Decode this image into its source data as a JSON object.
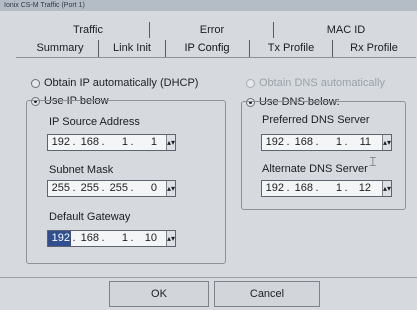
{
  "window": {
    "title": "Ionix CS-M Traffic (Port 1)"
  },
  "tabs": {
    "back_row": [
      "Traffic",
      "Error",
      "MAC ID"
    ],
    "front_row": [
      "Summary",
      "Link Init",
      "IP Config",
      "Tx Profile",
      "Rx Profile"
    ],
    "selected": "IP Config"
  },
  "ip_mode": {
    "auto_label": "Obtain IP automatically (DHCP)",
    "manual_label": "Use IP below",
    "selected": "Use IP below"
  },
  "ip_fields": {
    "source": {
      "label": "IP Source Address",
      "octets": [
        "192",
        "168",
        "1",
        "1"
      ]
    },
    "mask": {
      "label": "Subnet Mask",
      "octets": [
        "255",
        "255",
        "255",
        "0"
      ]
    },
    "gateway": {
      "label": "Default Gateway",
      "octets": [
        "192",
        "168",
        "1",
        "10"
      ],
      "highlighted_octet": 0
    }
  },
  "dns_mode": {
    "auto_label": "Obtain DNS automatically",
    "auto_disabled": true,
    "manual_label": "Use DNS below:",
    "selected": "Use DNS below:"
  },
  "dns_fields": {
    "preferred": {
      "label": "Preferred DNS Server",
      "octets": [
        "192",
        "168",
        "1",
        "11"
      ]
    },
    "alternate": {
      "label": "Alternate DNS Server",
      "octets": [
        "192",
        "168",
        "1",
        "12"
      ]
    }
  },
  "buttons": {
    "ok": "OK",
    "cancel": "Cancel"
  },
  "spinner_glyph": "▴▾",
  "colors": {
    "selection": "#2f4f91",
    "panel": "#d6dadf",
    "field_bg": "#f4f5f6"
  }
}
